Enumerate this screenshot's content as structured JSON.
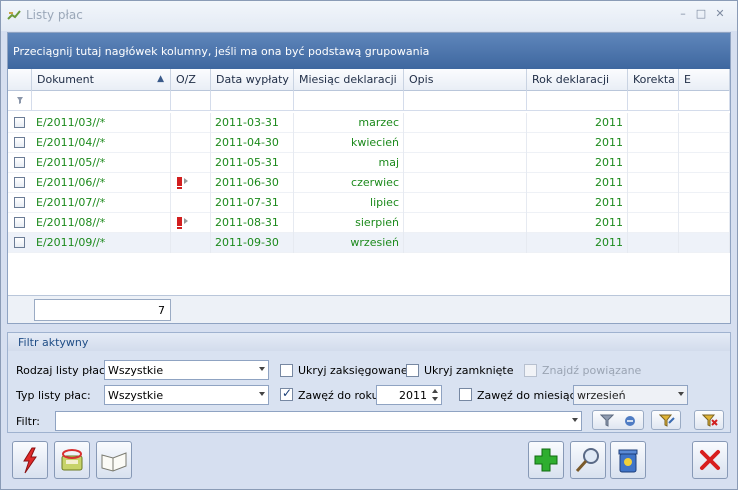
{
  "window": {
    "title": "Listy płac"
  },
  "grid": {
    "group_hint": "Przeciągnij tutaj nagłówek kolumny, jeśli ma ona być podstawą grupowania",
    "columns": [
      "Dokument",
      "O/Z",
      "Data wypłaty",
      "Miesiąc deklaracji",
      "Opis",
      "Rok deklaracji",
      "Korekta",
      "E"
    ],
    "sort_indicator": "▲",
    "rows": [
      {
        "dokument": "E/2011/03//*",
        "oz_flag": false,
        "data": "2011-03-31",
        "miesiac": "marzec",
        "opis": "",
        "rok": "2011",
        "korekta": "",
        "e": ""
      },
      {
        "dokument": "E/2011/04//*",
        "oz_flag": false,
        "data": "2011-04-30",
        "miesiac": "kwiecień",
        "opis": "",
        "rok": "2011",
        "korekta": "",
        "e": ""
      },
      {
        "dokument": "E/2011/05//*",
        "oz_flag": false,
        "data": "2011-05-31",
        "miesiac": "maj",
        "opis": "",
        "rok": "2011",
        "korekta": "",
        "e": ""
      },
      {
        "dokument": "E/2011/06//*",
        "oz_flag": true,
        "data": "2011-06-30",
        "miesiac": "czerwiec",
        "opis": "",
        "rok": "2011",
        "korekta": "",
        "e": ""
      },
      {
        "dokument": "E/2011/07//*",
        "oz_flag": false,
        "data": "2011-07-31",
        "miesiac": "lipiec",
        "opis": "",
        "rok": "2011",
        "korekta": "",
        "e": ""
      },
      {
        "dokument": "E/2011/08//*",
        "oz_flag": true,
        "data": "2011-08-31",
        "miesiac": "sierpień",
        "opis": "",
        "rok": "2011",
        "korekta": "",
        "e": ""
      },
      {
        "dokument": "E/2011/09//*",
        "oz_flag": false,
        "data": "2011-09-30",
        "miesiac": "wrzesień",
        "opis": "",
        "rok": "2011",
        "korekta": "",
        "e": ""
      }
    ],
    "count": "7"
  },
  "filter": {
    "title": "Filtr aktywny",
    "rodzaj_label": "Rodzaj listy płac:",
    "rodzaj_value": "Wszystkie",
    "typ_label": "Typ listy płac:",
    "typ_value": "Wszystkie",
    "filtr_label": "Filtr:",
    "filtr_value": "",
    "ukryj_zaksiegowane": "Ukryj zaksięgowane",
    "ukryj_zamkniete": "Ukryj zamknięte",
    "znajdz_powiazane": "Znajdź powiązane",
    "zawez_do_roku": "Zawęź do roku",
    "rok_value": "2011",
    "zawez_do_miesiaca": "Zawęź do miesiąca",
    "miesiac_value": "wrzesień"
  },
  "colors": {
    "accent": "#3e679f",
    "row_text": "#1c8a1c"
  },
  "icons": [
    "minimize-icon",
    "maximize-icon",
    "close-icon",
    "lightning-icon",
    "export-icon",
    "book-icon",
    "add-icon",
    "search-icon",
    "delete-icon",
    "cancel-icon",
    "filter-icon"
  ]
}
